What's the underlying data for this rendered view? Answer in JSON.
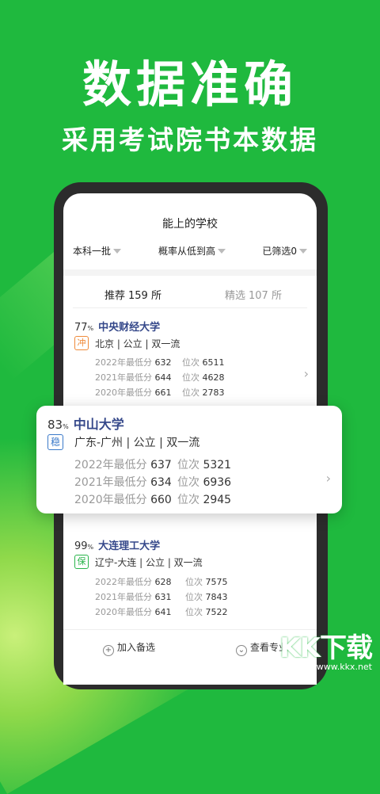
{
  "hero": {
    "title": "数据准确",
    "subtitle": "采用考试院书本数据"
  },
  "screen": {
    "title": "能上的学校",
    "filters": [
      "本科一批",
      "概率从低到高",
      "已筛选0"
    ],
    "tabs": [
      {
        "label": "推荐",
        "count": "159 所"
      },
      {
        "label": "精选",
        "count": "107 所"
      }
    ]
  },
  "cards": [
    {
      "pct": "77",
      "pct_unit": "%",
      "name": "中央财经大学",
      "badge": "冲",
      "tags": "北京 | 公立 | 双一流",
      "stats": [
        {
          "year_label": "2022年最低分",
          "score": "632",
          "rank_label": "位次",
          "rank": "6511"
        },
        {
          "year_label": "2021年最低分",
          "score": "644",
          "rank_label": "位次",
          "rank": "4628"
        },
        {
          "year_label": "2020年最低分",
          "score": "661",
          "rank_label": "位次",
          "rank": "2783"
        }
      ]
    },
    {
      "pct": "83",
      "pct_unit": "%",
      "name": "中山大学",
      "badge": "稳",
      "tags": "广东-广州 | 公立 | 双一流",
      "stats": [
        {
          "year_label": "2022年最低分",
          "score": "637",
          "rank_label": "位次",
          "rank": "5321"
        },
        {
          "year_label": "2021年最低分",
          "score": "634",
          "rank_label": "位次",
          "rank": "6936"
        },
        {
          "year_label": "2020年最低分",
          "score": "660",
          "rank_label": "位次",
          "rank": "2945"
        }
      ]
    },
    {
      "pct": "99",
      "pct_unit": "%",
      "name": "大连理工大学",
      "badge": "保",
      "tags": "辽宁-大连 | 公立 | 双一流",
      "stats": [
        {
          "year_label": "2022年最低分",
          "score": "628",
          "rank_label": "位次",
          "rank": "7575"
        },
        {
          "year_label": "2021年最低分",
          "score": "631",
          "rank_label": "位次",
          "rank": "7843"
        },
        {
          "year_label": "2020年最低分",
          "score": "641",
          "rank_label": "位次",
          "rank": "7522"
        }
      ]
    }
  ],
  "bottom_bar": {
    "add_label": "加入备选",
    "view_label": "查看专业"
  },
  "icons": {
    "chevron": "chevron-right-icon",
    "plus": "plus-circle-icon",
    "down": "chevron-down-circle-icon"
  },
  "watermark": {
    "logo": "KK下载",
    "url": "www.kkx.net"
  },
  "colors": {
    "brand_green": "#1fb93e",
    "name_blue": "#35488a",
    "chong": "#ef8a3a",
    "wen": "#3a79c9",
    "bao": "#28b44a"
  }
}
